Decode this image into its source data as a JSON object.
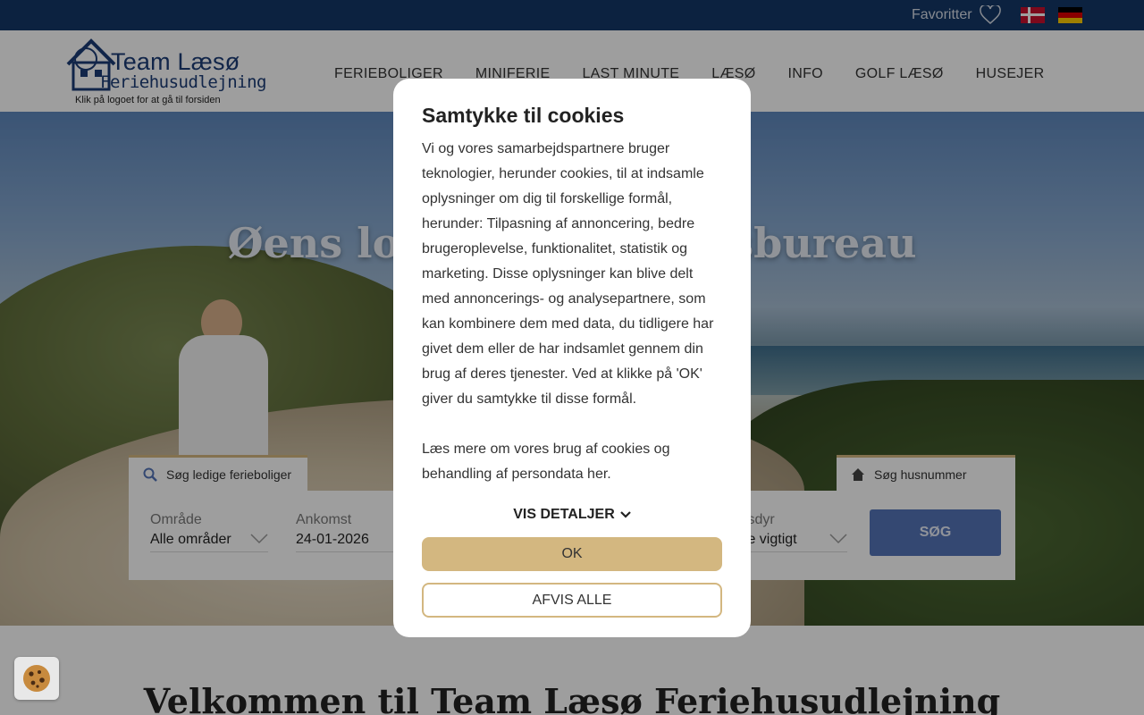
{
  "topbar": {
    "favorites_label": "Favoritter",
    "languages": [
      "Dansk",
      "Deutsch"
    ]
  },
  "header": {
    "logo_title": "Team Læsø",
    "logo_subtitle": "Feriehusudlejning",
    "logo_hint": "Klik på logoet for at gå til forsiden",
    "nav": [
      "FERIEBOLIGER",
      "MINIFERIE",
      "LAST MINUTE",
      "LÆSØ",
      "INFO",
      "GOLF LÆSØ",
      "HUSEJER"
    ]
  },
  "hero": {
    "title": "Øens lokale udlejningsbureau"
  },
  "search": {
    "tab_search_label": "Søg ledige ferieboliger",
    "tab_house_number_label": "Søg husnummer",
    "area_label": "Område",
    "area_value": "Alle områder",
    "arrival_label": "Ankomst",
    "arrival_value": "24-01-2026",
    "pets_label": "Husdyr",
    "pets_value": "Ikke vigtigt",
    "search_button": "SØG"
  },
  "welcome_heading": "Velkommen til Team Læsø Feriehusudlejning",
  "cookie_dialog": {
    "title": "Samtykke til cookies",
    "body": "Vi og vores samarbejdspartnere bruger teknologier, herunder cookies, til at indsamle oplysninger om dig til forskellige formål, herunder: Tilpasning af annoncering, bedre brugeroplevelse, funktionalitet, statistik og marketing. Disse oplysninger kan blive delt med annoncerings- og analysepartnere, som kan kombinere dem med data, du tidligere har givet dem eller de har indsamlet gennem din brug af deres tjenester. Ved at klikke på 'OK' giver du samtykke til disse formål.",
    "read_more": "Læs mere om vores brug af cookies og behandling af persondata her.",
    "details_label": "VIS DETALJER",
    "ok_label": "OK",
    "reject_label": "AFVIS ALLE"
  },
  "colors": {
    "topbar": "#143868",
    "accent_gold": "#d3b780",
    "search_button": "#5575b8"
  },
  "icons": [
    "heart-icon",
    "search-icon",
    "home-icon",
    "chevron-down-icon",
    "cookie-icon"
  ]
}
